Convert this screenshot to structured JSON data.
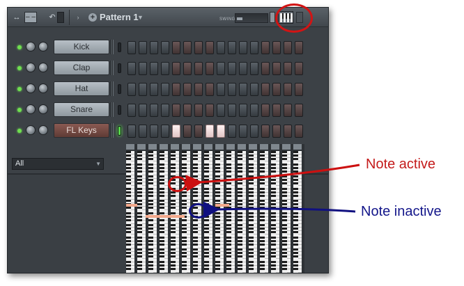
{
  "toolbar": {
    "move_icon": "↔",
    "view_label": "– –",
    "undo_icon": "↶",
    "arrow_icon": "›",
    "pattern_add_icon": "+",
    "pattern_name": "Pattern 1",
    "swing_label": "SWING",
    "piano_roll_button": "piano-roll-icon"
  },
  "channels": [
    {
      "name": "Kick",
      "selected": false,
      "active_steps": []
    },
    {
      "name": "Clap",
      "selected": false,
      "active_steps": []
    },
    {
      "name": "Hat",
      "selected": false,
      "active_steps": []
    },
    {
      "name": "Snare",
      "selected": false,
      "active_steps": []
    },
    {
      "name": "FL Keys",
      "selected": true,
      "active_steps": [
        4,
        7,
        8
      ]
    }
  ],
  "steps_per_row": 16,
  "filter": {
    "value": "All"
  },
  "annotations": {
    "active": "Note active",
    "inactive": "Note inactive"
  },
  "colors": {
    "accent_red": "#c41b1b",
    "accent_blue": "#13168a",
    "led_green": "#6fe04f",
    "note_salmon": "#f3a98c"
  }
}
